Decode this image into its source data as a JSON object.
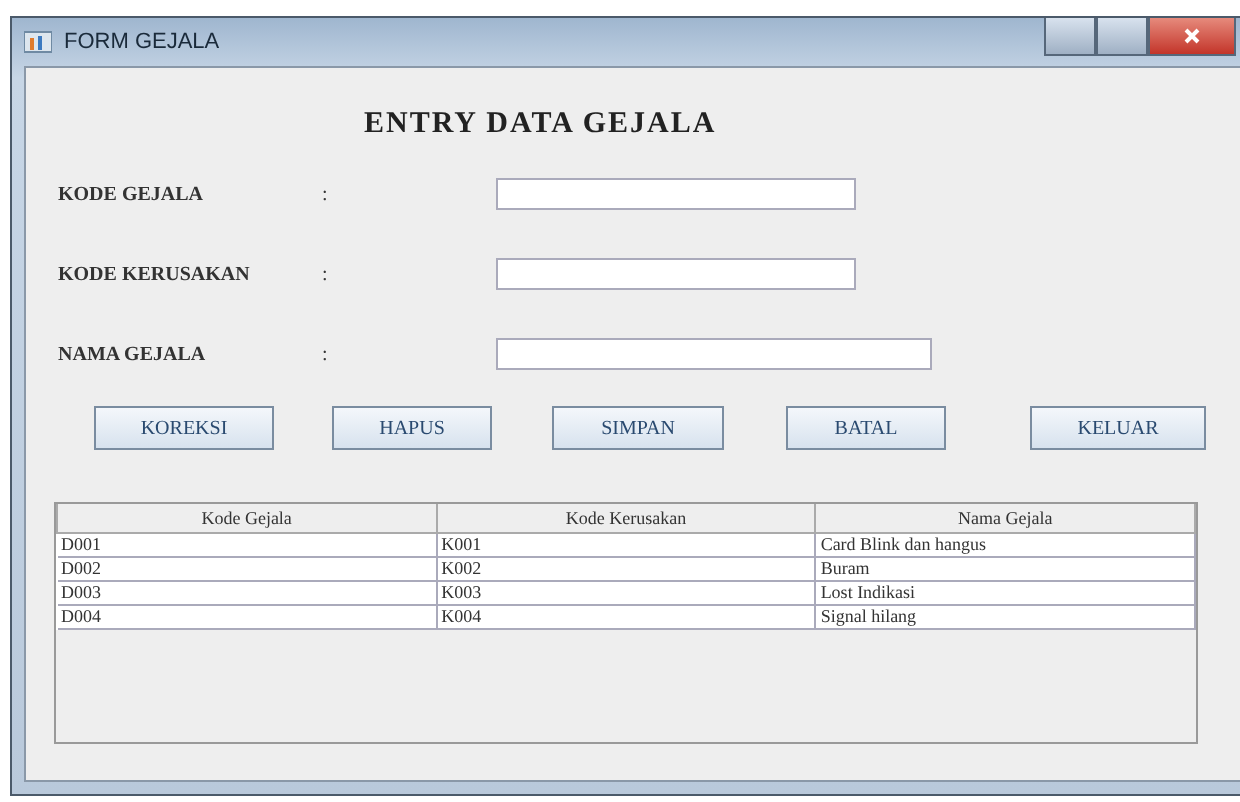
{
  "window": {
    "title": "FORM GEJALA"
  },
  "heading": "ENTRY DATA GEJALA",
  "fields": [
    {
      "label": "KODE GEJALA",
      "colon": ":"
    },
    {
      "label": "KODE KERUSAKAN",
      "colon": ":"
    },
    {
      "label": "NAMA GEJALA",
      "colon": ":"
    }
  ],
  "buttons": [
    "KOREKSI",
    "HAPUS",
    "SIMPAN",
    "BATAL",
    "KELUAR"
  ],
  "table": {
    "columns": [
      "Kode Gejala",
      "Kode Kerusakan",
      "Nama Gejala"
    ],
    "rows": [
      [
        "D001",
        "K001",
        "Card Blink dan hangus"
      ],
      [
        "D002",
        "K002",
        "Buram"
      ],
      [
        "D003",
        "K003",
        "Lost Indikasi"
      ],
      [
        "D004",
        "K004",
        "Signal hilang"
      ]
    ]
  }
}
